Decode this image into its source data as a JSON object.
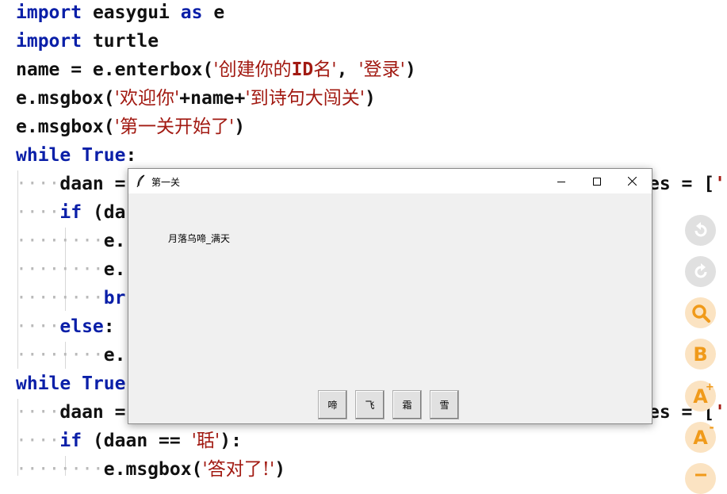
{
  "editor": {
    "lines": {
      "l1": {
        "kw1": "import",
        "mod": "easygui",
        "kw2": "as",
        "alias": "e"
      },
      "l2": {
        "kw": "import",
        "mod": "turtle"
      },
      "l3": {
        "lhs": "name = e.enterbox(",
        "s1": "'创建你的",
        "s1b": "ID",
        "s1c": "名'",
        "mid": ", ",
        "s2": "'登录'",
        "end": ")"
      },
      "l4": {
        "pre": "e.msgbox(",
        "s1": "'欢迎你'",
        "mid": "+name+",
        "s2": "'到诗句大闯关'",
        "end": ")"
      },
      "l5": {
        "pre": "e.msgbox(",
        "s1": "'第一关开始了'",
        "end": ")"
      },
      "l6": {
        "kw": "while",
        "val": "True",
        "end": ":"
      },
      "l7": {
        "dots": "····",
        "code": "daan =",
        "right": "es = [",
        "rq": "'"
      },
      "l8": {
        "dots": "····",
        "kw": "if",
        "code": " (da"
      },
      "l9": {
        "dots": "········",
        "code": "e."
      },
      "l10": {
        "dots": "········",
        "code": "e."
      },
      "l11": {
        "dots": "········",
        "kw": "br"
      },
      "l12": {
        "dots": "····",
        "kw": "else",
        "end": ":"
      },
      "l13": {
        "dots": "········",
        "code": "e."
      },
      "l14": {
        "kw": "while",
        "val": "True"
      },
      "l15": {
        "dots": "····",
        "code": "daan =",
        "right": "es = [",
        "rq": "'"
      },
      "l16": {
        "dots": "····",
        "kw": "if",
        "code": " (daan == ",
        "s": "'聒'",
        "end": "):"
      },
      "l17": {
        "dots": "········",
        "code": "e.msgbox(",
        "s": "'答对了!'",
        "end": ")"
      }
    }
  },
  "dialog": {
    "title": "第一关",
    "message": "月落乌啼_满天",
    "choices": [
      "啼",
      "飞",
      "霜",
      "雪"
    ]
  },
  "tools": {
    "tool_b": "B",
    "tool_a_plus": "A",
    "tool_a_plus_sup": "+",
    "tool_a_minus": "A",
    "tool_a_minus_sup": "-"
  },
  "colors": {
    "keyword": "#0a1fa8",
    "string": "#a21a12",
    "tool_orange": "#f09a1a",
    "tool_orange_bg": "#fbe3c2",
    "tool_gray_bg": "#e0e0e0"
  }
}
